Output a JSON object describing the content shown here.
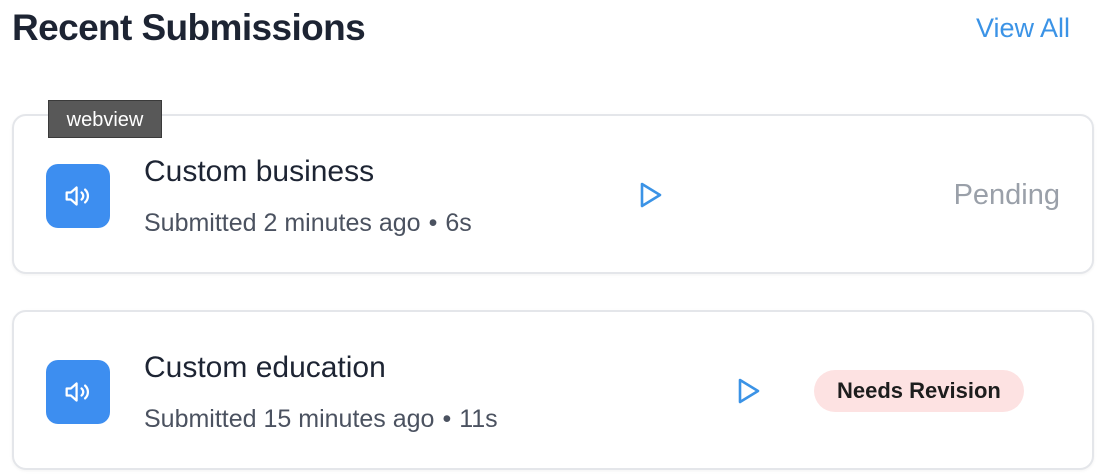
{
  "header": {
    "title": "Recent Submissions",
    "view_all_label": "View All"
  },
  "tooltip": {
    "text": "webview"
  },
  "submissions": [
    {
      "title": "Custom business",
      "submitted": "Submitted 2 minutes ago",
      "separator": "•",
      "duration": "6s",
      "status": "Pending",
      "status_style": "plain"
    },
    {
      "title": "Custom education",
      "submitted": "Submitted 15 minutes ago",
      "separator": "•",
      "duration": "11s",
      "status": "Needs Revision",
      "status_style": "badge"
    }
  ],
  "icons": {
    "audio": "speaker-icon",
    "play": "play-icon"
  },
  "colors": {
    "accent": "#3b93e6",
    "icon_bg": "#3d8ef0",
    "badge_bg": "#fde2e2",
    "pending_text": "#9aa0a9"
  }
}
